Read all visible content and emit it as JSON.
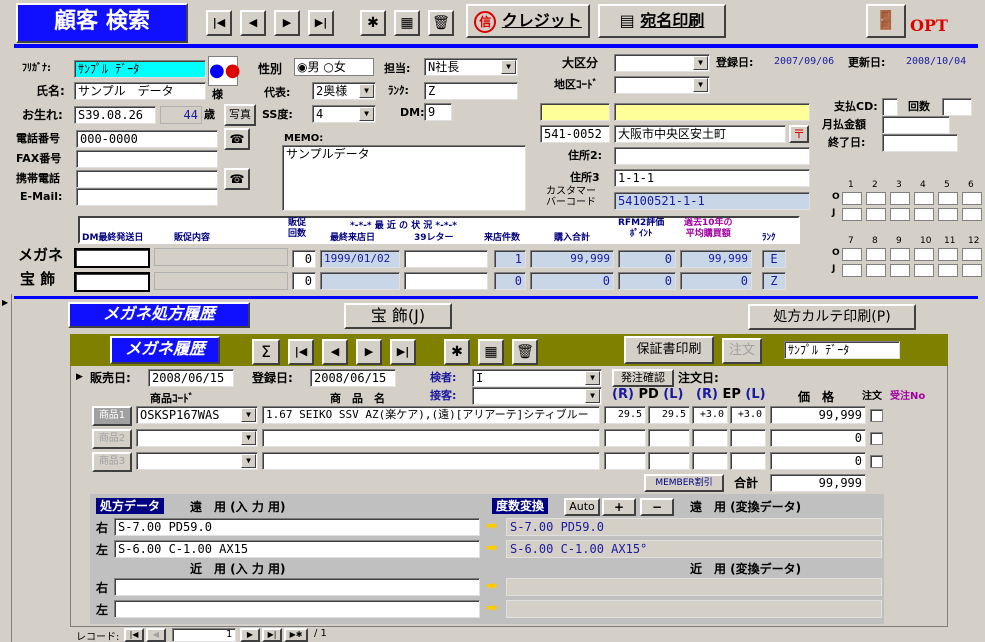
{
  "header": {
    "title": "顧客 検索",
    "credit_label": "クレジット",
    "credit_icon": "信",
    "label_print": "宛名印刷",
    "opt": "OPT"
  },
  "customer": {
    "furigana_label": "ﾌﾘｶﾞﾅ:",
    "furigana": "ｻﾝﾌﾟﾙ ﾃﾞｰﾀ",
    "name_label": "氏名:",
    "name": "サンプル　データ",
    "sama": "様",
    "birth_label": "お生れ:",
    "birth": "S39.08.26",
    "age": "44",
    "age_unit": "歳",
    "photo_label": "写真",
    "phone_label": "電話番号",
    "phone": "000-0000",
    "fax_label": "FAX番号",
    "mobile_label": "携帯電話",
    "email_label": "E-Mail:",
    "gender_label": "性別",
    "gender_male": "男",
    "gender_female": "女",
    "rep_label": "代表:",
    "rep": "2奥様",
    "ss_label": "SS度:",
    "ss": "4",
    "memo_label": "MEMO:",
    "memo": "サンプルデータ",
    "staff_label": "担当:",
    "staff": "N社長",
    "rank_label": "ﾗﾝｸ:",
    "rank": "Z",
    "dm_label": "DM:",
    "dm": "9",
    "major_label": "大区分",
    "area_label": "地区ｺｰﾄﾞ",
    "zip": "541-0052",
    "addr1": "大阪市中央区安土町",
    "addr2_label": "住所2:",
    "addr3_label": "住所3",
    "addr3": "1-1-1",
    "barcode_label1": "カスタマー",
    "barcode_label2": "バーコード",
    "barcode": "54100521-1-1",
    "reg_date_label": "登録日:",
    "reg_date": "2007/09/06",
    "upd_date_label": "更新日:",
    "upd_date": "2008/10/04",
    "pay_cd_label": "支払CD:",
    "count_label": "回数",
    "monthly_label": "月払金額",
    "end_label": "終了日:"
  },
  "month_grid": {
    "row1_nums": [
      "1",
      "2",
      "3",
      "4",
      "5",
      "6"
    ],
    "row2_nums": [
      "7",
      "8",
      "9",
      "10",
      "11",
      "12"
    ],
    "o": "O",
    "j": "J"
  },
  "status": {
    "headers": [
      "DM最終発送日",
      "販促内容",
      "販促\n回数",
      "最終来店日",
      "39レター",
      "来店件数",
      "購入合計",
      "RFM2評価\nﾎﾟｲﾝﾄ",
      "過去10年の\n平均購買額",
      "ﾗﾝｸ"
    ],
    "hanso_top": "販促",
    "hanso_bottom": "回数",
    "recent_title": "*-*-* 最 近 の 状 況 *-*-*",
    "rfm_top": "RFM2評価",
    "rfm_bottom": "ﾎﾟｲﾝﾄ",
    "avg_top": "過去10年の",
    "avg_bottom": "平均購買額",
    "glasses_label": "メガネ",
    "jewelry_label": "宝 飾",
    "glasses": {
      "count": "0",
      "last_visit": "1999/01/02",
      "visits": "1",
      "total": "99,999",
      "point": "0",
      "avg": "99,999",
      "rank": "E"
    },
    "jewelry": {
      "count": "0",
      "visits": "0",
      "total": "0",
      "point": "0",
      "avg": "0",
      "rank": "Z"
    }
  },
  "sub": {
    "title": "メガネ処方履歴",
    "jewelry_btn": "宝 飾(J)",
    "karte_btn": "処方カルテ印刷(P)",
    "history_title": "メガネ履歴",
    "sigma": "Σ",
    "warranty_btn": "保証書印刷",
    "chumon_btn": "注文",
    "customer_name": "ｻﾝﾌﾟﾙ ﾃﾞｰﾀ",
    "sale_date_label": "販売日:",
    "sale_date": "2008/06/15",
    "reg_date_label": "登録日:",
    "reg_date": "2008/06/15",
    "inspector_label": "検者:",
    "inspector": "I",
    "order_confirm": "発注確認",
    "order_date_label": "注文日:",
    "attendant_label": "接客:",
    "col_code": "商品ｺｰﾄﾞ",
    "col_name": "商　品　名",
    "col_rpd": "(R)",
    "col_pd": "PD",
    "col_lpd": "(L)",
    "col_rep": "(R)",
    "col_ep": "EP",
    "col_lep": "(L)",
    "col_price": "価　格",
    "col_order": "注文",
    "col_orderno": "受注No",
    "items": [
      {
        "label": "商品1",
        "code": "OSKSP167WAS",
        "name": "1.67 SEIKO SSV AZ(楽ケア),(遠)[アリアーテ]シティブルー",
        "pdr": "29.5",
        "pdl": "29.5",
        "epr": "+3.0",
        "epl": "+3.0",
        "price": "99,999"
      },
      {
        "label": "商品2",
        "code": "",
        "name": "",
        "pdr": "",
        "pdl": "",
        "epr": "",
        "epl": "",
        "price": "0"
      },
      {
        "label": "商品3",
        "code": "",
        "name": "",
        "pdr": "",
        "pdl": "",
        "epr": "",
        "epl": "",
        "price": "0"
      }
    ],
    "member_btn": "MEMBER割引",
    "total_label": "合計",
    "total": "99,999",
    "rx_label": "処方データ",
    "far_input": "遠　用 (入 力 用)",
    "near_input": "近　用 (入 力 用)",
    "convert_label": "度数変換",
    "auto_btn": "Auto",
    "plus_btn": "+",
    "minus_btn": "−",
    "far_conv": "遠　用 (変換データ)",
    "near_conv": "近　用 (変換データ)",
    "right": "右",
    "left": "左",
    "far_r": "S-7.00 PD59.0",
    "far_l": "S-6.00 C-1.00 AX15",
    "far_r_conv": "S-7.00 PD59.0",
    "far_l_conv": "S-6.00 C-1.00 AX15°"
  },
  "record": {
    "label": "レコード:",
    "current": "1",
    "total": "/ 1"
  },
  "colors": {
    "accent": "#0000ff",
    "title_bg": "#1010ff",
    "olive": "#808000",
    "navy": "#000080",
    "convert_text": "#1a1aa0"
  }
}
